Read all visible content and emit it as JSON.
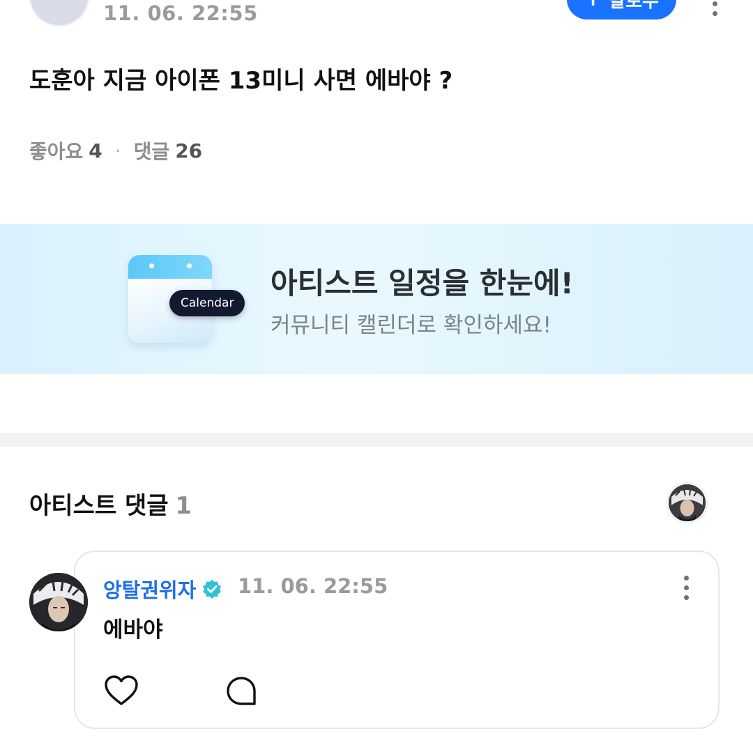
{
  "post": {
    "date": "11. 06. 22:55",
    "follow_label": "팔로우",
    "follow_icon": "plus-icon",
    "title": "도훈아 지금 아이폰 13미니 사면 에바야 ?",
    "stats": {
      "likes_label": "좋아요",
      "likes_count": "4",
      "separator": "·",
      "comments_label": "댓글",
      "comments_count": "26"
    }
  },
  "banner": {
    "calendar_badge": "Calendar",
    "title": "아티스트 일정을 한눈에!",
    "subtitle": "커뮤니티 캘린더로 확인하세요!",
    "colors": {
      "background": "#dff4fd",
      "badge_bg": "#131a2f",
      "calendar_top": "#5bc8f7"
    }
  },
  "artist_comments": {
    "title": "아티스트 댓글",
    "count": "1",
    "comment": {
      "author": "앙탈권위자",
      "verified_icon": "verified-badge-icon",
      "date": "11. 06. 22:55",
      "text": "에바야",
      "actions": [
        "heart-icon",
        "reply-bubble-icon"
      ]
    }
  },
  "colors": {
    "accent": "#1a73ff",
    "author": "#1e6fe8",
    "verified": "#2ec4d6",
    "muted": "#9a9a9f"
  }
}
